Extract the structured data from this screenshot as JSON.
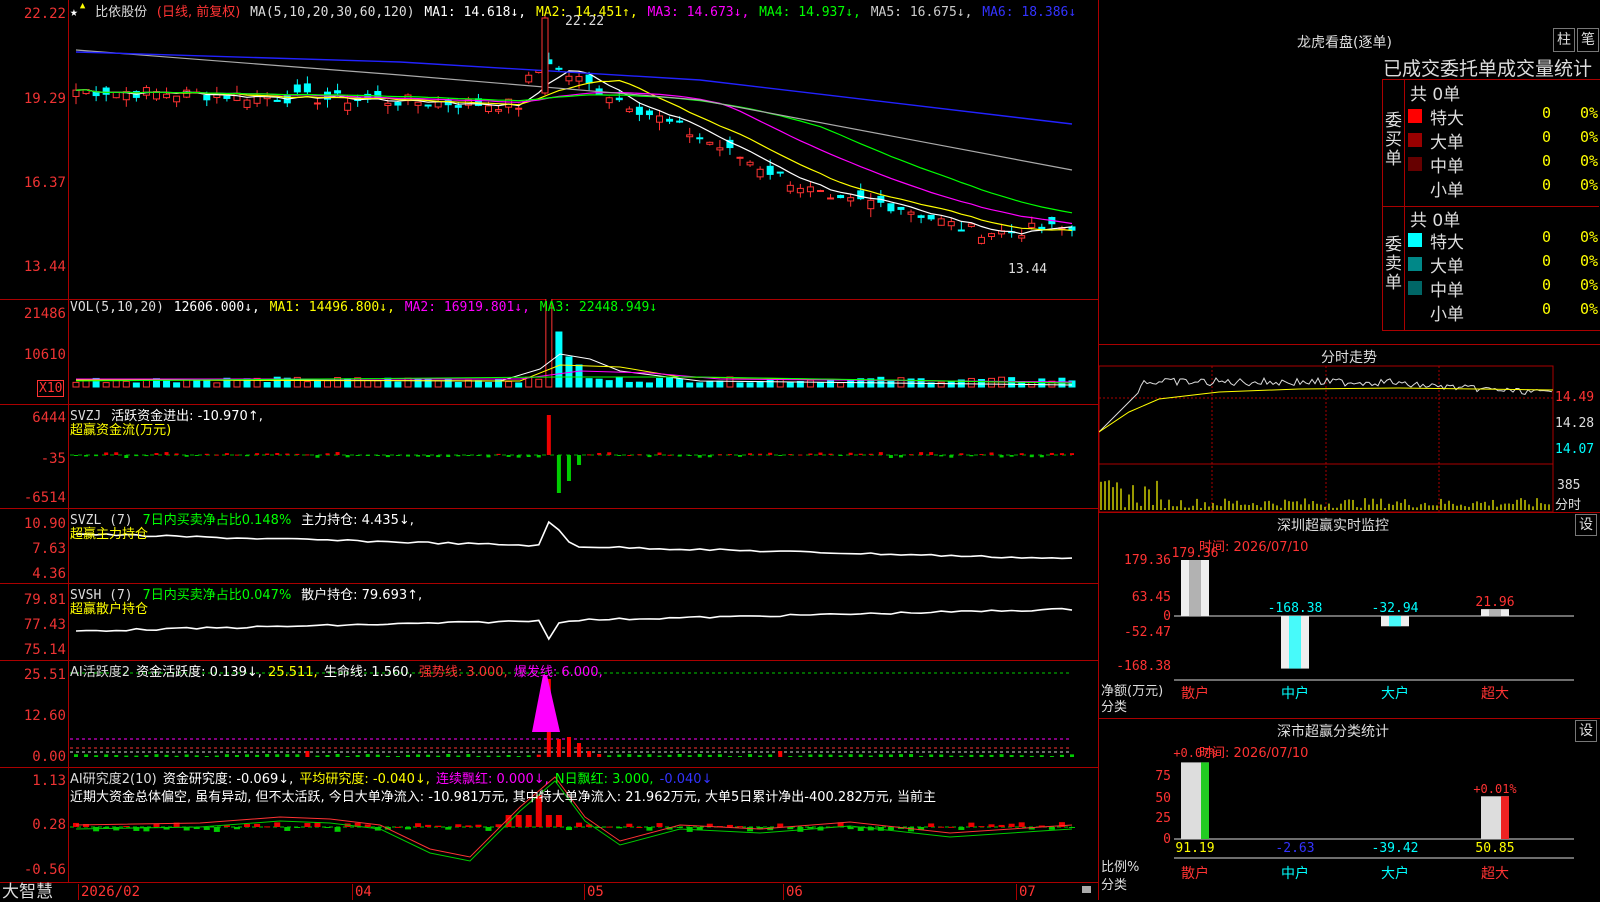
{
  "stock": {
    "name": "比依股份",
    "mode": "(日线, 前复权)",
    "ma_label": "MA(5,10,20,30,60,120)",
    "ma1": "MA1: 14.618↓,",
    "ma2": "MA2: 14.451↑,",
    "ma3": "MA3: 14.673↓,",
    "ma4": "MA4: 14.937↓,",
    "ma5": "MA5: 16.675↓,",
    "ma6": "MA6: 18.386↓"
  },
  "price_axis": [
    "22.22",
    "19.29",
    "16.37",
    "13.44"
  ],
  "price_annot_high": "22.22",
  "price_annot_low": "13.44",
  "vol": {
    "label": "VOL(5,10,20)",
    "value": "12606.000↓,",
    "ma1": "MA1: 14496.800↓,",
    "ma2": "MA2: 16919.801↓,",
    "ma3": "MA3: 22448.949↓",
    "axis": [
      "21486",
      "10610"
    ],
    "unit": "X10"
  },
  "svzj": {
    "label": "SVZJ",
    "desc": "活跃资金进出: -10.970↑,",
    "sub": "超赢资金流(万元)",
    "axis": [
      "6444",
      "-35",
      "-6514"
    ]
  },
  "svzl": {
    "label": "SVZL (7)",
    "desc1": "7日内买卖净占比0.148%",
    "desc2": "主力持仓: 4.435↓,",
    "sub": "超赢主力持仓",
    "axis": [
      "10.90",
      "7.63",
      "4.36"
    ]
  },
  "svsh": {
    "label": "SVSH (7)",
    "desc1": "7日内买卖净占比0.047%",
    "desc2": "散户持仓: 79.693↑,",
    "sub": "超赢散户持仓",
    "axis": [
      "79.81",
      "77.43",
      "75.14"
    ]
  },
  "ai1": {
    "label": "AI活跃度2",
    "d1": "资金活跃度: 0.139↓,",
    "d2": "25.511,",
    "d3": "生命线: 1.560,",
    "d4": "强势线: 3.000,",
    "d5": "爆发线: 6.000,",
    "axis": [
      "25.51",
      "12.60",
      "0.00"
    ]
  },
  "ai2": {
    "label": "AI研究度2(10)",
    "d1": "资金研究度: -0.069↓,",
    "d2": "平均研究度: -0.040↓,",
    "d3": "连续飘红: 0.000↓,",
    "d4": "N日飘红: 3.000,",
    "d5": "-0.040↓",
    "comment": "近期大资金总体偏空, 虽有异动, 但不太活跃, 今日大单净流入: -10.981万元, 其中特大单净流入: 21.962万元, 大单5日累计净出-400.282万元, 当前主",
    "axis": [
      "1.13",
      "0.28",
      "-0.56"
    ]
  },
  "xaxis": {
    "brand": "大智慧",
    "labels": [
      "2026/02",
      "04",
      "05",
      "06",
      "07"
    ]
  },
  "longhu": {
    "title": "龙虎看盘(逐单)",
    "btn1": "柱",
    "btn2": "笔",
    "header": "已成交委托单成交量统计",
    "buy_label": "委买单",
    "sell_label": "委卖单",
    "buy_total": "共 0单",
    "sell_total": "共 0单",
    "buy_rows": [
      {
        "name": "特大",
        "count": "0",
        "pct": "0%",
        "color": "#ff0000"
      },
      {
        "name": "大单",
        "count": "0",
        "pct": "0%",
        "color": "#990000"
      },
      {
        "name": "中单",
        "count": "0",
        "pct": "0%",
        "color": "#660000"
      },
      {
        "name": "小单",
        "count": "0",
        "pct": "0%",
        "color": "#000000"
      }
    ],
    "sell_rows": [
      {
        "name": "特大",
        "count": "0",
        "pct": "0%",
        "color": "#00ffff"
      },
      {
        "name": "大单",
        "count": "0",
        "pct": "0%",
        "color": "#008888"
      },
      {
        "name": "中单",
        "count": "0",
        "pct": "0%",
        "color": "#006666"
      },
      {
        "name": "小单",
        "count": "0",
        "pct": "0%",
        "color": "#000000"
      }
    ]
  },
  "intraday": {
    "title": "分时走势",
    "axis": [
      "14.49",
      "14.28",
      "14.07"
    ],
    "vol_axis": [
      "385",
      "分时"
    ]
  },
  "sz_monitor": {
    "title": "深圳超赢实时监控",
    "btn": "设",
    "time": "时间: 2026/07/10",
    "axis": [
      "179.36",
      "63.45",
      "0",
      "-52.47",
      "-168.38"
    ],
    "unit1": "净额(万元)",
    "unit2": "分类",
    "bars": [
      {
        "cat": "散户",
        "value": "179.36"
      },
      {
        "cat": "中户",
        "value": "-168.38"
      },
      {
        "cat": "大户",
        "value": "-32.94"
      },
      {
        "cat": "超大",
        "value": "21.96"
      }
    ]
  },
  "sz_stats": {
    "title": "深市超赢分类统计",
    "btn": "设",
    "time": "时间: 2026/07/10",
    "axis": [
      "75",
      "50",
      "25",
      "0"
    ],
    "unit1": "比例%",
    "unit2": "分类",
    "top_left": "+0.07%",
    "top_right": "+0.01%",
    "bars": [
      {
        "cat": "散户",
        "value": "91.19"
      },
      {
        "cat": "中户",
        "value": "-2.63"
      },
      {
        "cat": "大户",
        "value": "-39.42"
      },
      {
        "cat": "超大",
        "value": "50.85"
      }
    ]
  },
  "colors": {
    "up": "#ff3333",
    "down": "#00ffff",
    "frame": "#aa0000",
    "ma1": "#ffffff",
    "ma2": "#ffff00",
    "ma3": "#ff00ff",
    "ma4": "#00ff00",
    "ma5": "#aaaaaa",
    "ma6": "#2222ff"
  }
}
